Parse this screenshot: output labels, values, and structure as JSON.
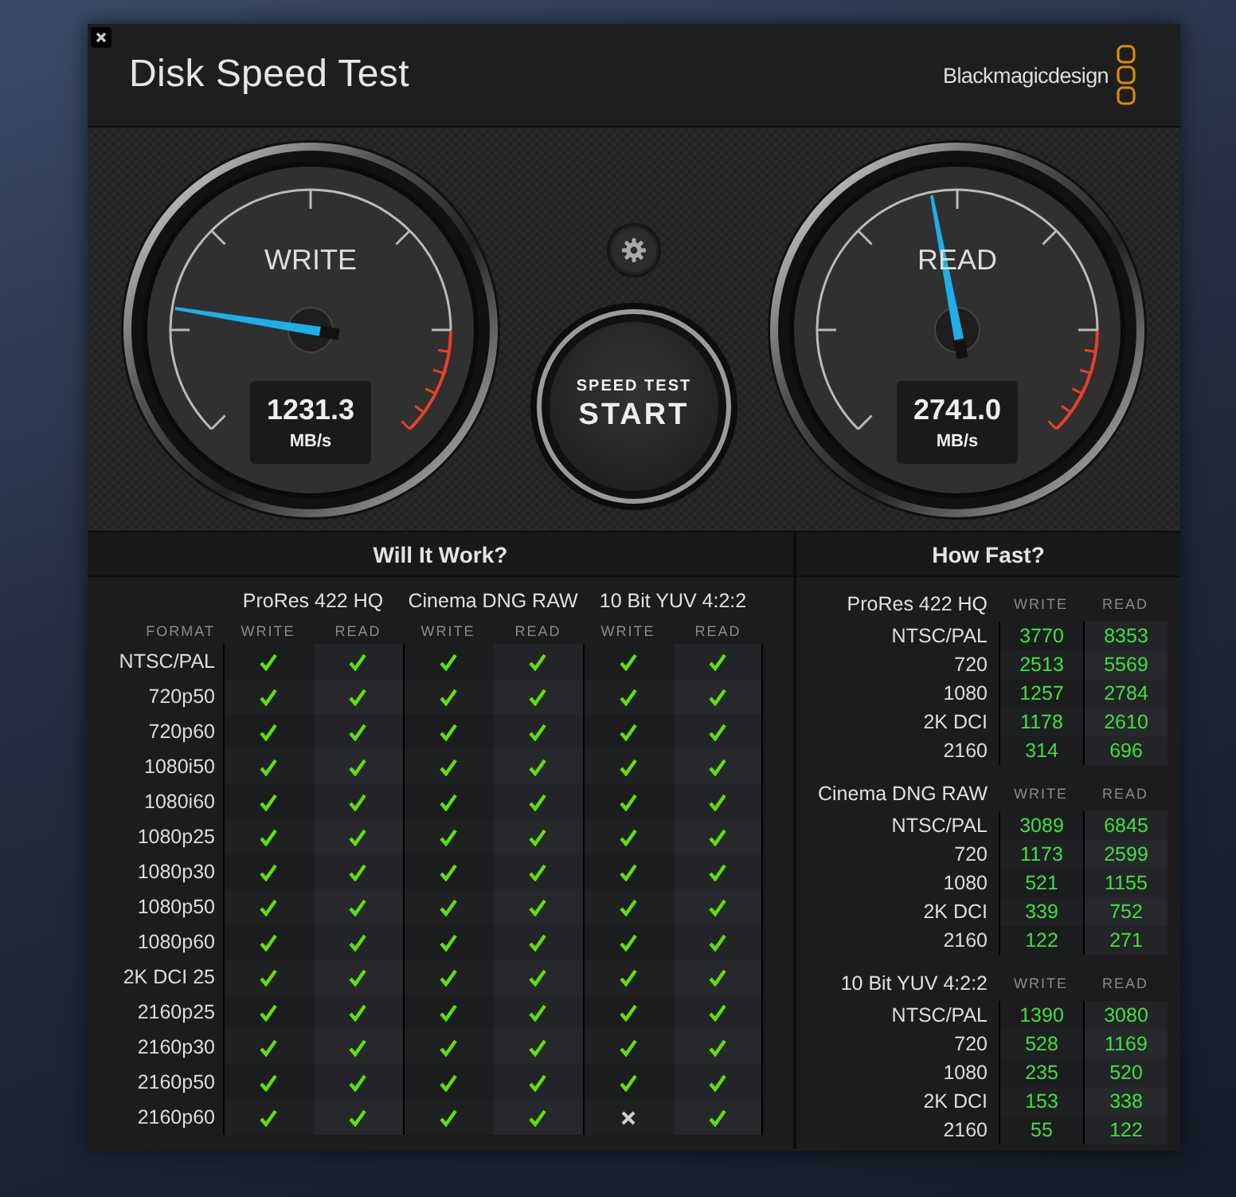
{
  "window": {
    "title": "Disk Speed Test",
    "logo": "Blackmagicdesign"
  },
  "gauges": [
    {
      "label": "WRITE",
      "value": "1231.3",
      "unit": "MB/s",
      "level": 0.2
    },
    {
      "label": "READ",
      "value": "2741.0",
      "unit": "MB/s",
      "level": 0.46
    }
  ],
  "start_button": {
    "caption": "SPEED TEST",
    "label": "START"
  },
  "will_it_work": {
    "title": "Will It Work?",
    "format_header": "FORMAT",
    "codecs": [
      {
        "name": "ProRes 422 HQ",
        "columns": [
          "WRITE",
          "READ"
        ]
      },
      {
        "name": "Cinema DNG RAW",
        "columns": [
          "WRITE",
          "READ"
        ]
      },
      {
        "name": "10 Bit YUV 4:2:2",
        "columns": [
          "WRITE",
          "READ"
        ]
      }
    ],
    "rows": [
      {
        "format": "NTSC/PAL",
        "results": [
          true,
          true,
          true,
          true,
          true,
          true
        ]
      },
      {
        "format": "720p50",
        "results": [
          true,
          true,
          true,
          true,
          true,
          true
        ]
      },
      {
        "format": "720p60",
        "results": [
          true,
          true,
          true,
          true,
          true,
          true
        ]
      },
      {
        "format": "1080i50",
        "results": [
          true,
          true,
          true,
          true,
          true,
          true
        ]
      },
      {
        "format": "1080i60",
        "results": [
          true,
          true,
          true,
          true,
          true,
          true
        ]
      },
      {
        "format": "1080p25",
        "results": [
          true,
          true,
          true,
          true,
          true,
          true
        ]
      },
      {
        "format": "1080p30",
        "results": [
          true,
          true,
          true,
          true,
          true,
          true
        ]
      },
      {
        "format": "1080p50",
        "results": [
          true,
          true,
          true,
          true,
          true,
          true
        ]
      },
      {
        "format": "1080p60",
        "results": [
          true,
          true,
          true,
          true,
          true,
          true
        ]
      },
      {
        "format": "2K DCI 25",
        "results": [
          true,
          true,
          true,
          true,
          true,
          true
        ]
      },
      {
        "format": "2160p25",
        "results": [
          true,
          true,
          true,
          true,
          true,
          true
        ]
      },
      {
        "format": "2160p30",
        "results": [
          true,
          true,
          true,
          true,
          true,
          true
        ]
      },
      {
        "format": "2160p50",
        "results": [
          true,
          true,
          true,
          true,
          true,
          true
        ]
      },
      {
        "format": "2160p60",
        "results": [
          true,
          true,
          true,
          true,
          false,
          true
        ]
      }
    ]
  },
  "how_fast": {
    "title": "How Fast?",
    "groups": [
      {
        "codec": "ProRes 422 HQ",
        "columns": [
          "WRITE",
          "READ"
        ],
        "rows": [
          {
            "format": "NTSC/PAL",
            "write": "3770",
            "read": "8353"
          },
          {
            "format": "720",
            "write": "2513",
            "read": "5569"
          },
          {
            "format": "1080",
            "write": "1257",
            "read": "2784"
          },
          {
            "format": "2K DCI",
            "write": "1178",
            "read": "2610"
          },
          {
            "format": "2160",
            "write": "314",
            "read": "696"
          }
        ]
      },
      {
        "codec": "Cinema DNG RAW",
        "columns": [
          "WRITE",
          "READ"
        ],
        "rows": [
          {
            "format": "NTSC/PAL",
            "write": "3089",
            "read": "6845"
          },
          {
            "format": "720",
            "write": "1173",
            "read": "2599"
          },
          {
            "format": "1080",
            "write": "521",
            "read": "1155"
          },
          {
            "format": "2K DCI",
            "write": "339",
            "read": "752"
          },
          {
            "format": "2160",
            "write": "122",
            "read": "271"
          }
        ]
      },
      {
        "codec": "10 Bit YUV 4:2:2",
        "columns": [
          "WRITE",
          "READ"
        ],
        "rows": [
          {
            "format": "NTSC/PAL",
            "write": "1390",
            "read": "3080"
          },
          {
            "format": "720",
            "write": "528",
            "read": "1169"
          },
          {
            "format": "1080",
            "write": "235",
            "read": "520"
          },
          {
            "format": "2K DCI",
            "write": "153",
            "read": "338"
          },
          {
            "format": "2160",
            "write": "55",
            "read": "122"
          }
        ]
      }
    ]
  }
}
